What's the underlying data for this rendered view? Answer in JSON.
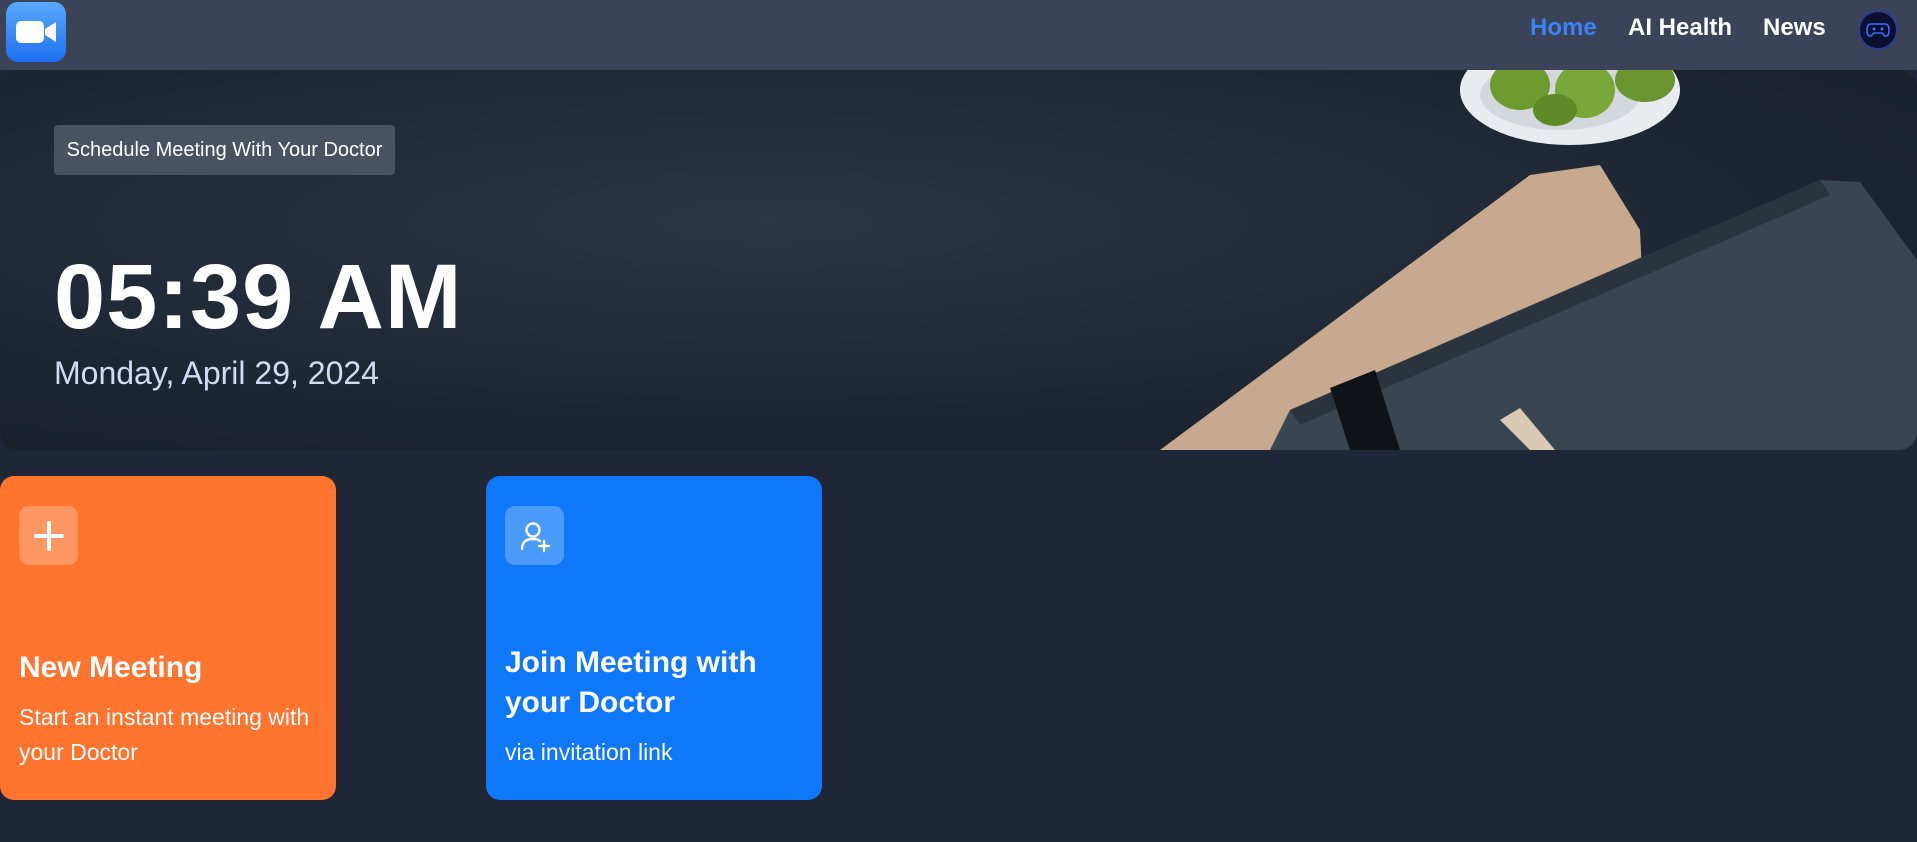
{
  "nav": {
    "logo_icon": "video-camera-icon",
    "items": [
      {
        "label": "Home",
        "active": true
      },
      {
        "label": "AI Health",
        "active": false
      },
      {
        "label": "News",
        "active": false
      }
    ],
    "avatar_icon": "gamepad-icon"
  },
  "hero": {
    "schedule_label": "Schedule Meeting With Your Doctor",
    "time": "05:39 AM",
    "date": "Monday, April 29, 2024"
  },
  "cards": [
    {
      "icon": "plus-icon",
      "title": "New Meeting",
      "subtitle": "Start an instant meeting with your Doctor",
      "color": "#ff742e"
    },
    {
      "icon": "add-user-icon",
      "title": "Join Meeting with your Doctor",
      "subtitle": "via invitation link",
      "color": "#0e78f9"
    }
  ],
  "colors": {
    "topbar": "#3a4357",
    "background": "#1f2637",
    "nav_active": "#3b82f6"
  }
}
